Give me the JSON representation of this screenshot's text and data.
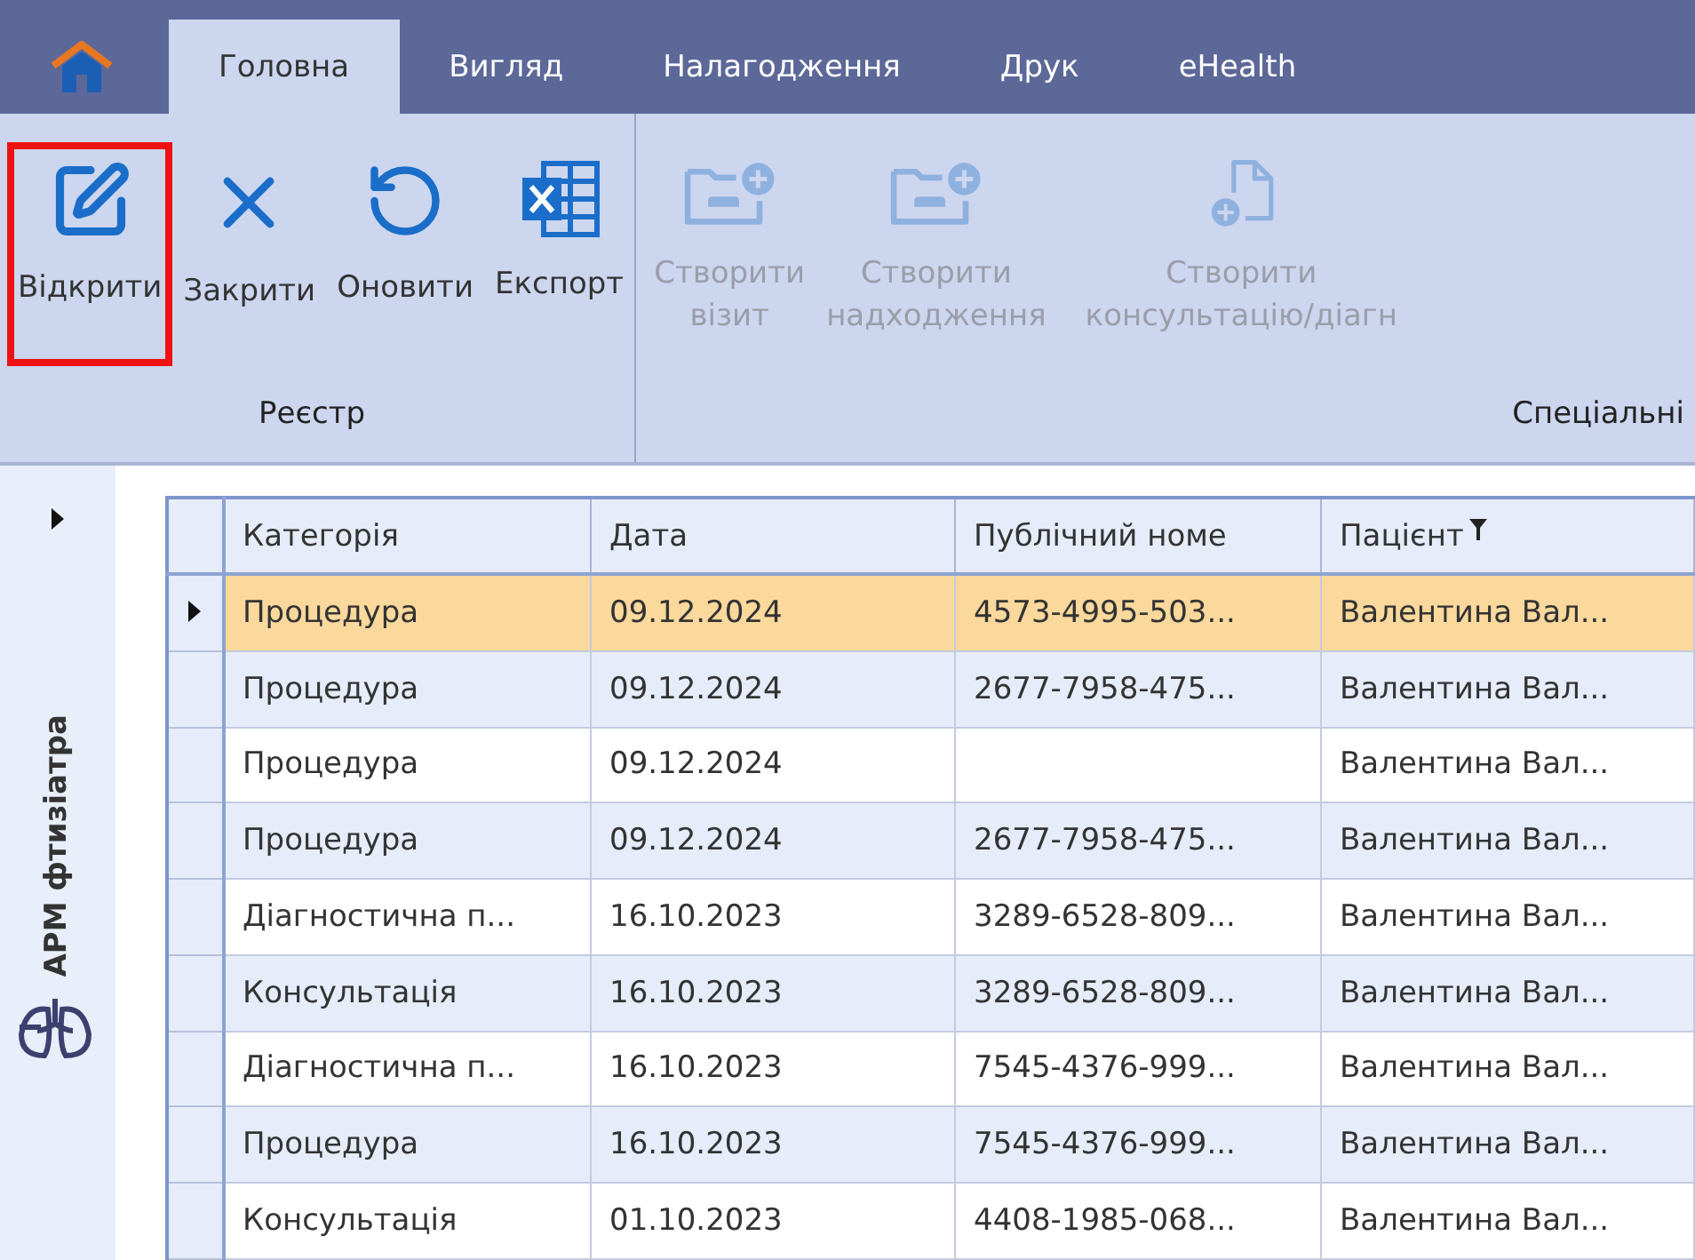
{
  "tabs": [
    {
      "label": "Головна",
      "selected": true
    },
    {
      "label": "Вигляд",
      "selected": false
    },
    {
      "label": "Налагодження",
      "selected": false
    },
    {
      "label": "Друк",
      "selected": false
    },
    {
      "label": "eHealth",
      "selected": false
    }
  ],
  "ribbon_groups": [
    {
      "label": "Реєстр",
      "buttons": [
        {
          "kind": "edit",
          "label": "Відкрити",
          "disabled": false,
          "highlighted": true
        },
        {
          "kind": "close",
          "label": "Закрити",
          "disabled": false,
          "highlighted": false
        },
        {
          "kind": "refresh",
          "label": "Оновити",
          "disabled": false,
          "highlighted": false
        },
        {
          "kind": "excel",
          "label": "Експорт",
          "disabled": false,
          "highlighted": false
        }
      ]
    },
    {
      "label": "Спеціальні",
      "buttons": [
        {
          "kind": "folder",
          "label": "Створити\nвізит",
          "disabled": true,
          "highlighted": false
        },
        {
          "kind": "folder",
          "label": "Створити\nнадходження",
          "disabled": true,
          "highlighted": false
        },
        {
          "kind": "file",
          "label": "Створити\nконсультацію/діагн",
          "disabled": true,
          "highlighted": false
        }
      ]
    }
  ],
  "sidebar": {
    "title": "АРМ фтизіатра",
    "expanded": false
  },
  "table": {
    "columns": [
      {
        "label": "Категорія",
        "filtered": false
      },
      {
        "label": "Дата",
        "filtered": false
      },
      {
        "label": "Публічний номе",
        "filtered": false
      },
      {
        "label": "Пацієнт",
        "filtered": true
      }
    ],
    "rows": [
      {
        "selected": true,
        "cells": [
          "Процедура",
          "09.12.2024",
          "4573-4995-503...",
          "Валентина Вал..."
        ]
      },
      {
        "selected": false,
        "cells": [
          "Процедура",
          "09.12.2024",
          "2677-7958-475...",
          "Валентина Вал..."
        ]
      },
      {
        "selected": false,
        "cells": [
          "Процедура",
          "09.12.2024",
          "",
          "Валентина Вал..."
        ]
      },
      {
        "selected": false,
        "cells": [
          "Процедура",
          "09.12.2024",
          "2677-7958-475...",
          "Валентина Вал..."
        ]
      },
      {
        "selected": false,
        "cells": [
          "Діагностична п...",
          "16.10.2023",
          "3289-6528-809...",
          "Валентина Вал..."
        ]
      },
      {
        "selected": false,
        "cells": [
          "Консультація",
          "16.10.2023",
          "3289-6528-809...",
          "Валентина Вал..."
        ]
      },
      {
        "selected": false,
        "cells": [
          "Діагностична п...",
          "16.10.2023",
          "7545-4376-999...",
          "Валентина Вал..."
        ]
      },
      {
        "selected": false,
        "cells": [
          "Процедура",
          "16.10.2023",
          "7545-4376-999...",
          "Валентина Вал..."
        ]
      },
      {
        "selected": false,
        "cells": [
          "Консультація",
          "01.10.2023",
          "4408-1985-068...",
          "Валентина Вал..."
        ]
      }
    ]
  }
}
